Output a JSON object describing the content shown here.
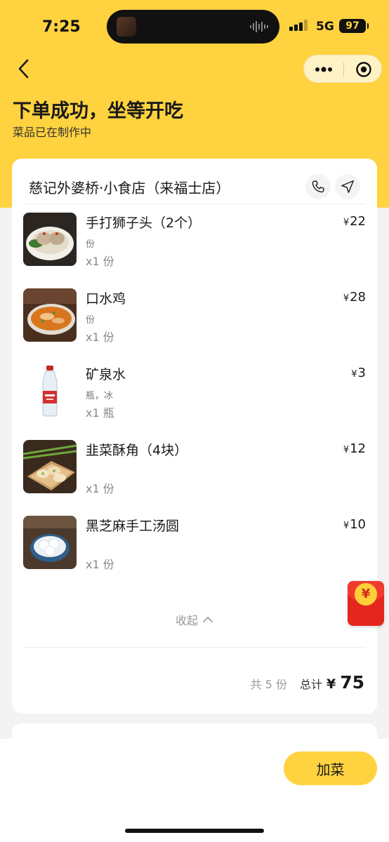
{
  "status_bar": {
    "time": "7:25",
    "network": "5G",
    "battery": "97"
  },
  "header": {
    "title": "下单成功，坐等开吃",
    "subtitle": "菜品已在制作中"
  },
  "store": {
    "name": "慈记外婆桥·小食店（来福士店）"
  },
  "currency_symbol": "¥",
  "items": [
    {
      "name": "手打狮子头（2个）",
      "spec": "份",
      "qty": "x1 份",
      "price": "22",
      "icon": "meatball-soup-photo"
    },
    {
      "name": "口水鸡",
      "spec": "份",
      "qty": "x1 份",
      "price": "28",
      "icon": "spicy-chicken-photo"
    },
    {
      "name": "矿泉水",
      "spec": "瓶，冰",
      "qty": "x1 瓶",
      "price": "3",
      "icon": "water-bottle-photo"
    },
    {
      "name": "韭菜酥角（4块）",
      "spec": "",
      "qty": "x1 份",
      "price": "12",
      "icon": "chive-pastry-photo"
    },
    {
      "name": "黑芝麻手工汤圆",
      "spec": "",
      "qty": "x1 份",
      "price": "10",
      "icon": "sesame-tangyuan-photo"
    }
  ],
  "collapse_label": "收起",
  "summary": {
    "count": "共 5 份",
    "total_label": "总计",
    "total": "75"
  },
  "red_packet_symbol": "¥",
  "bottom": {
    "add_button": "加菜"
  },
  "colors": {
    "brand_yellow": "#ffd23f",
    "red_packet": "#e5261f"
  }
}
